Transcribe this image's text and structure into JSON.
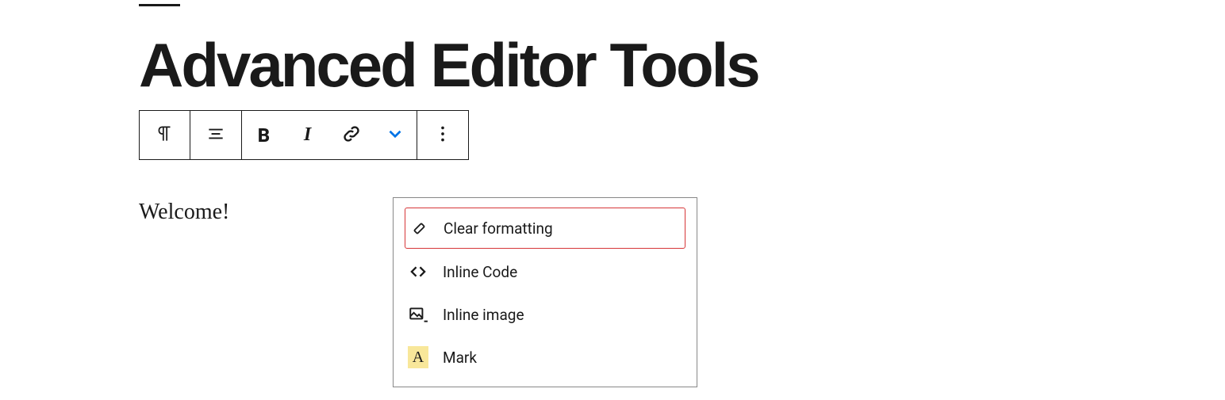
{
  "page": {
    "title": "Advanced Editor Tools"
  },
  "block": {
    "content": "Welcome!"
  },
  "toolbar": {
    "bold_label": "B",
    "italic_label": "I"
  },
  "dropdown": {
    "items": [
      {
        "label": "Clear formatting",
        "icon": "eraser-icon",
        "highlighted": true
      },
      {
        "label": "Inline Code",
        "icon": "code-icon",
        "highlighted": false
      },
      {
        "label": "Inline image",
        "icon": "image-icon",
        "highlighted": false
      },
      {
        "label": "Mark",
        "icon": "mark-icon",
        "highlighted": false
      }
    ],
    "mark_letter": "A"
  }
}
